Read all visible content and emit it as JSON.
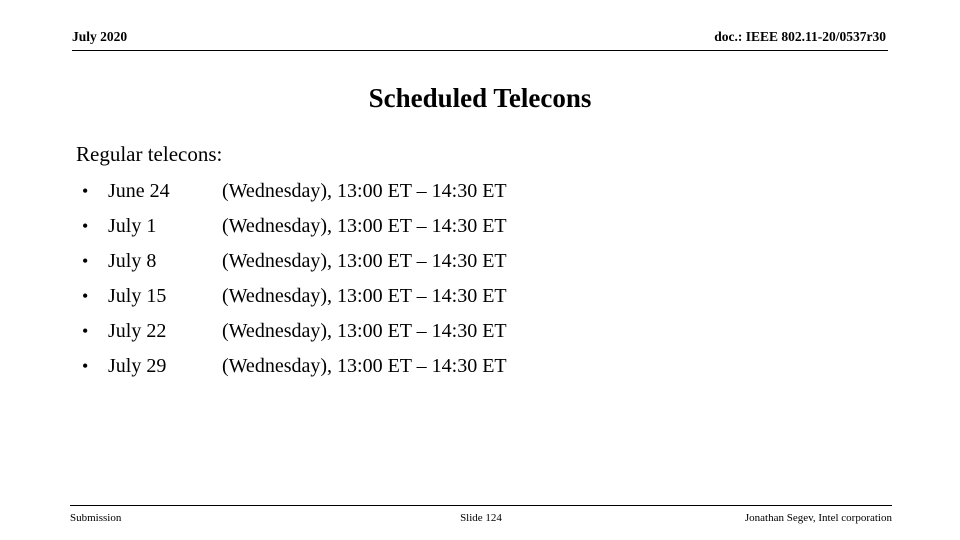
{
  "header": {
    "left": "July 2020",
    "right": "doc.: IEEE 802.11-20/0537r30"
  },
  "title": "Scheduled Telecons",
  "content": {
    "lead": "Regular telecons:",
    "bullet_glyph": "•",
    "rows": [
      {
        "date": "June 24",
        "details": "(Wednesday), 13:00 ET – 14:30 ET"
      },
      {
        "date": "July 1",
        "details": "(Wednesday), 13:00 ET – 14:30 ET"
      },
      {
        "date": "July 8",
        "details": "(Wednesday), 13:00 ET – 14:30 ET"
      },
      {
        "date": "July 15",
        "details": "(Wednesday), 13:00 ET – 14:30 ET"
      },
      {
        "date": "July 22",
        "details": "(Wednesday), 13:00 ET – 14:30 ET"
      },
      {
        "date": "July 29",
        "details": "(Wednesday), 13:00 ET – 14:30 ET"
      }
    ]
  },
  "footer": {
    "left": "Submission",
    "center": "Slide 124",
    "right": "Jonathan Segev, Intel corporation"
  },
  "colors": {
    "text": "#000000",
    "background": "#ffffff",
    "rule": "#000000"
  }
}
